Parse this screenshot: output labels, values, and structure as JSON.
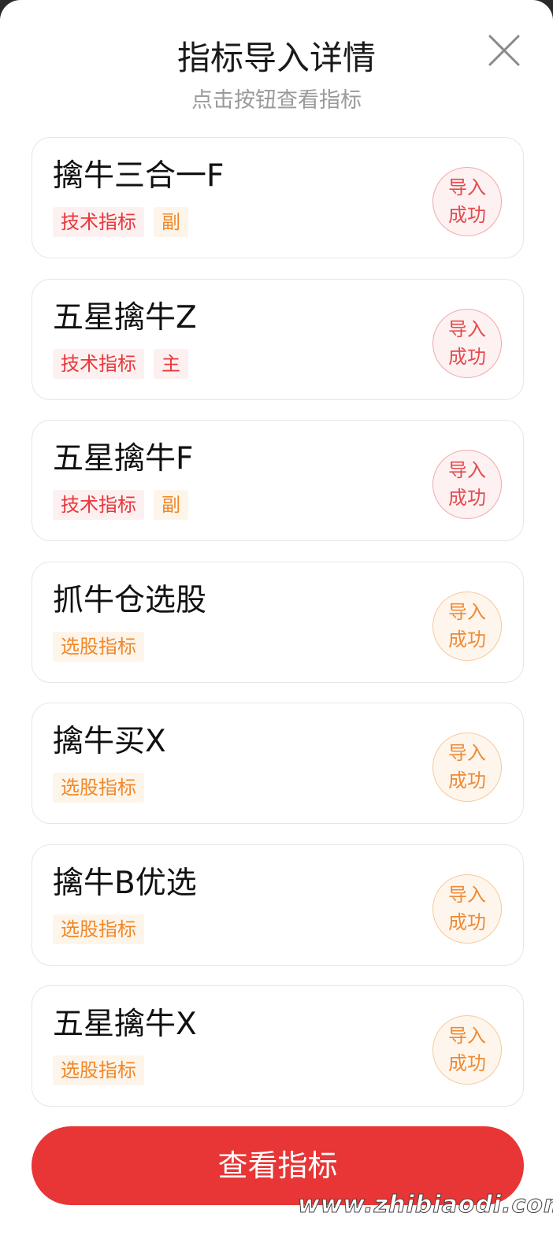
{
  "header": {
    "title": "指标导入详情",
    "subtitle": "点击按钮查看指标",
    "close_icon": "close-icon"
  },
  "colors": {
    "accent_red": "#e83535",
    "tag_red": "#e8383d",
    "tag_orange": "#f0882a"
  },
  "items": [
    {
      "name": "擒牛三合一F",
      "tags": [
        {
          "text": "技术指标",
          "color": "red"
        },
        {
          "text": "副",
          "color": "orange"
        }
      ],
      "status_line1": "导入",
      "status_line2": "成功",
      "status_color": "red"
    },
    {
      "name": "五星擒牛Z",
      "tags": [
        {
          "text": "技术指标",
          "color": "red"
        },
        {
          "text": "主",
          "color": "red"
        }
      ],
      "status_line1": "导入",
      "status_line2": "成功",
      "status_color": "red"
    },
    {
      "name": "五星擒牛F",
      "tags": [
        {
          "text": "技术指标",
          "color": "red"
        },
        {
          "text": "副",
          "color": "orange"
        }
      ],
      "status_line1": "导入",
      "status_line2": "成功",
      "status_color": "red"
    },
    {
      "name": "抓牛仓选股",
      "tags": [
        {
          "text": "选股指标",
          "color": "orange"
        }
      ],
      "status_line1": "导入",
      "status_line2": "成功",
      "status_color": "orange"
    },
    {
      "name": "擒牛买X",
      "tags": [
        {
          "text": "选股指标",
          "color": "orange"
        }
      ],
      "status_line1": "导入",
      "status_line2": "成功",
      "status_color": "orange"
    },
    {
      "name": "擒牛B优选",
      "tags": [
        {
          "text": "选股指标",
          "color": "orange"
        }
      ],
      "status_line1": "导入",
      "status_line2": "成功",
      "status_color": "orange"
    },
    {
      "name": "五星擒牛X",
      "tags": [
        {
          "text": "选股指标",
          "color": "orange"
        }
      ],
      "status_line1": "导入",
      "status_line2": "成功",
      "status_color": "orange"
    }
  ],
  "footer": {
    "view_button_label": "查看指标",
    "watermark": "www.zhibiaodi.com"
  }
}
